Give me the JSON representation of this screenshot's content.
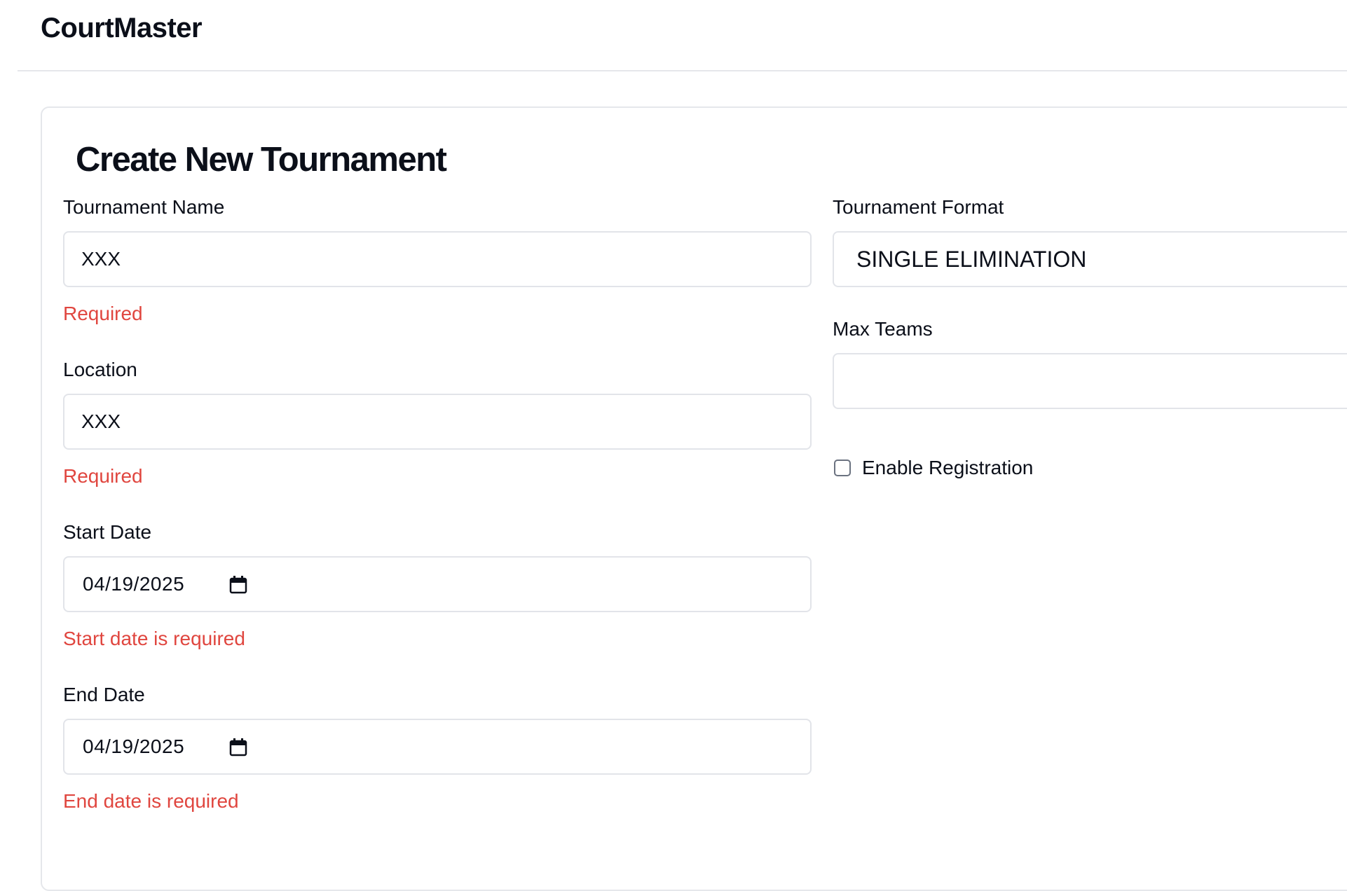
{
  "header": {
    "brand": "CourtMaster"
  },
  "form": {
    "title": "Create New Tournament",
    "tournament_name": {
      "label": "Tournament Name",
      "value": "XXX",
      "error": "Required"
    },
    "location": {
      "label": "Location",
      "value": "XXX",
      "error": "Required"
    },
    "start_date": {
      "label": "Start Date",
      "value": "04/19/2025",
      "error": "Start date is required"
    },
    "end_date": {
      "label": "End Date",
      "value": "04/19/2025",
      "error": "End date is required"
    },
    "tournament_format": {
      "label": "Tournament Format",
      "selected": "SINGLE ELIMINATION"
    },
    "max_teams": {
      "label": "Max Teams",
      "value": ""
    },
    "enable_registration": {
      "label": "Enable Registration",
      "checked": false
    }
  },
  "colors": {
    "error": "#e0463f",
    "border": "#e2e4e9",
    "text": "#0b0f19"
  },
  "icons": {
    "date_picker": "calendar-icon"
  }
}
